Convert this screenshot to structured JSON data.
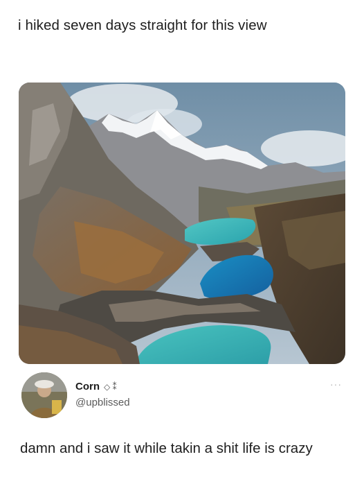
{
  "post": {
    "caption": "i hiked seven days straight for this view",
    "photo_alt": "mountain-lakes-photo"
  },
  "reply": {
    "name": "Corn",
    "badge_glyphs": "◇ ⁑",
    "handle": "@upblissed",
    "more_label": "···",
    "text": "damn and i saw it while takin a shit life is crazy"
  },
  "colors": {
    "lake_turquoise": "#34b4b8",
    "lake_blue": "#1d73b6",
    "sky": "#7f9cb2",
    "rock": "#6b5f52"
  }
}
